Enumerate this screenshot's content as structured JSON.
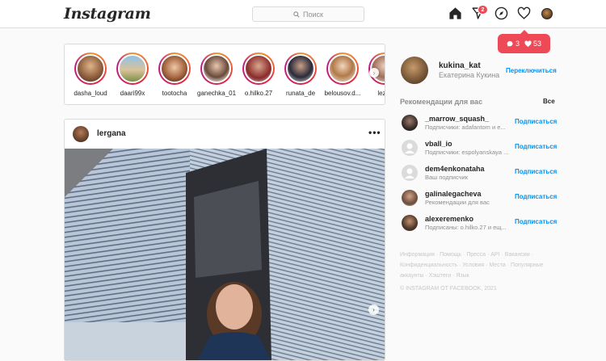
{
  "header": {
    "logo": "Instagram",
    "search_placeholder": "Поиск",
    "direct_badge": "2",
    "icons": [
      "home-icon",
      "direct-icon",
      "explore-icon",
      "heart-icon",
      "profile-avatar"
    ]
  },
  "notifications": {
    "comments": "3",
    "likes": "53"
  },
  "stories": [
    {
      "name": "dasha_loud"
    },
    {
      "name": "daari99x"
    },
    {
      "name": "tootocha"
    },
    {
      "name": "ganechka_01"
    },
    {
      "name": "o.hilko.27"
    },
    {
      "name": "runata_de"
    },
    {
      "name": "belousov.d..."
    },
    {
      "name": "lezhr"
    }
  ],
  "post": {
    "username": "lergana",
    "more": "•••"
  },
  "profile": {
    "username": "kukina_kat",
    "full_name": "Екатерина Кукина",
    "switch_label": "Переключиться"
  },
  "suggestions": {
    "title": "Рекомендации для вас",
    "see_all": "Все",
    "follow_label": "Подписаться",
    "items": [
      {
        "username": "_marrow_squash_",
        "subtitle": "Подписчики: adafantom и е..."
      },
      {
        "username": "vball_io",
        "subtitle": "Подписчики: espolyanskaya ..."
      },
      {
        "username": "dem4enkonataha",
        "subtitle": "Ваш подписчик"
      },
      {
        "username": "galinalegacheva",
        "subtitle": "Рекомендации для вас"
      },
      {
        "username": "alexeremenko",
        "subtitle": "Подписаны: o.hilko.27 и ещ..."
      }
    ]
  },
  "footer": {
    "links": "Информация · Помощь · Пресса · API · Вакансии · Конфиденциальность · Условия · Места · Популярные аккаунты · Хэштеги · Язык",
    "copyright": "© INSTAGRAM ОТ FACEBOOK, 2021"
  },
  "colors": {
    "accent": "#0095f6",
    "badge": "#ed4956",
    "border": "#dbdbdb",
    "muted": "#8e8e8e"
  }
}
